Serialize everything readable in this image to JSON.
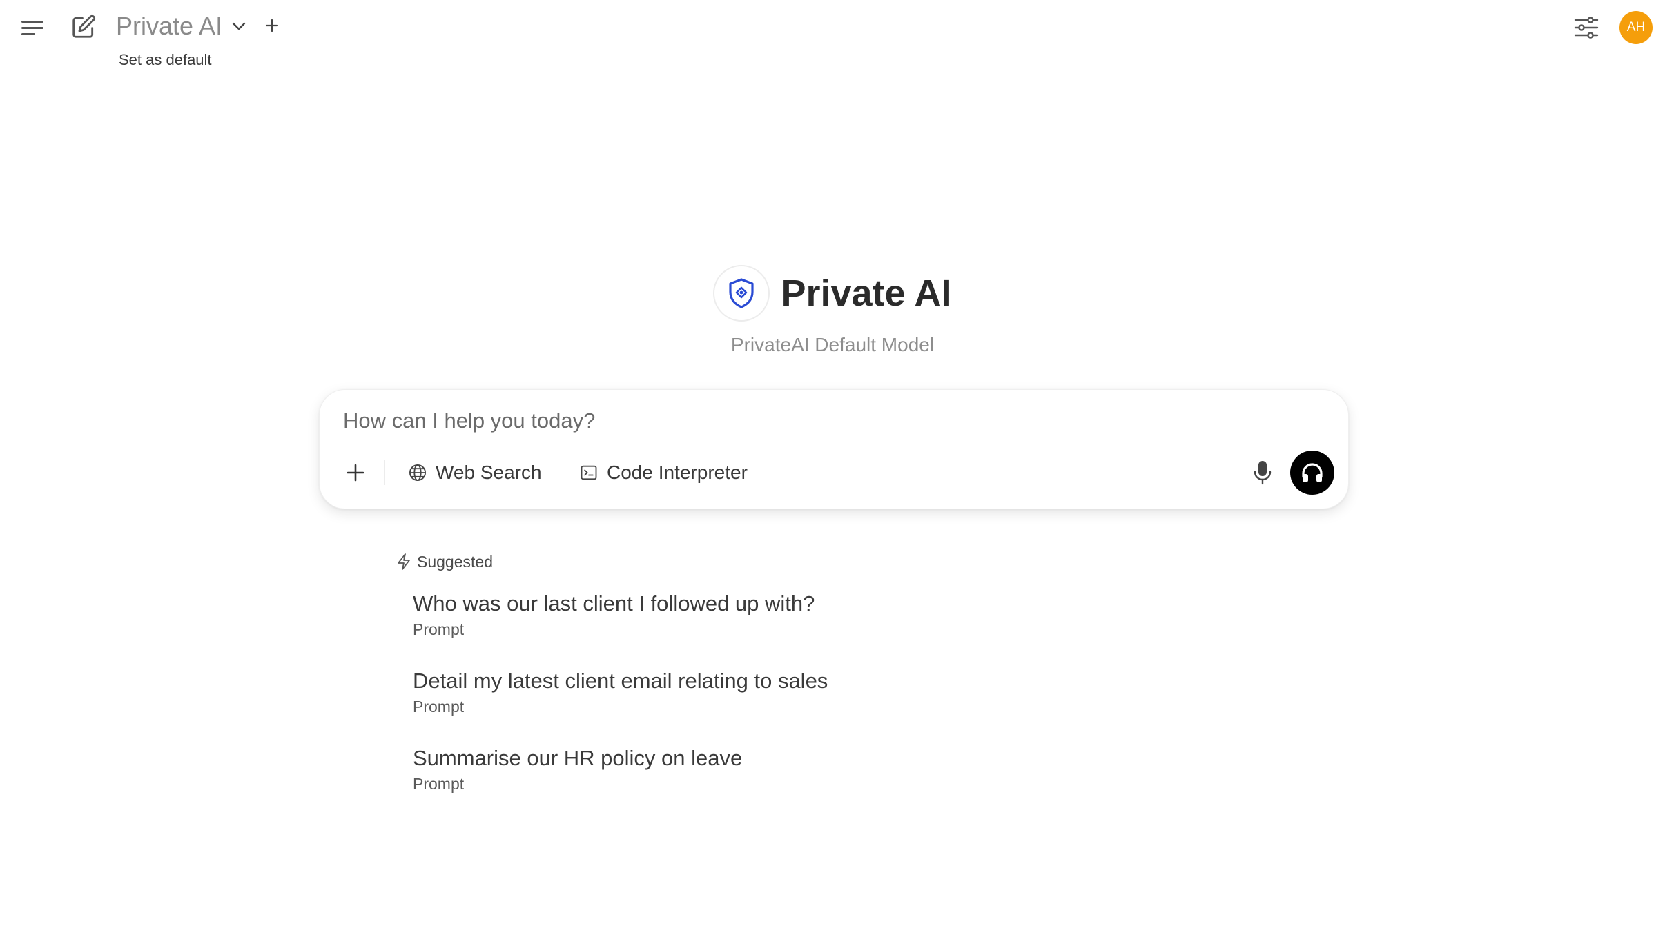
{
  "header": {
    "model_name": "Private AI",
    "set_default_label": "Set as default",
    "avatar_initials": "AH",
    "avatar_color": "#f59e0b"
  },
  "hero": {
    "title": "Private AI",
    "subtitle": "PrivateAI Default Model",
    "logo_icon": "shield-icon",
    "logo_color": "#2a4bd4"
  },
  "composer": {
    "placeholder": "How can I help you today?",
    "value": "",
    "tools": {
      "web_search_label": "Web Search",
      "code_interpreter_label": "Code Interpreter"
    }
  },
  "suggestions": {
    "header": "Suggested",
    "items": [
      {
        "title": "Who was our last client I followed up with?",
        "subtitle": "Prompt"
      },
      {
        "title": "Detail my latest client email relating to sales",
        "subtitle": "Prompt"
      },
      {
        "title": "Summarise our HR policy on leave",
        "subtitle": "Prompt"
      }
    ]
  }
}
